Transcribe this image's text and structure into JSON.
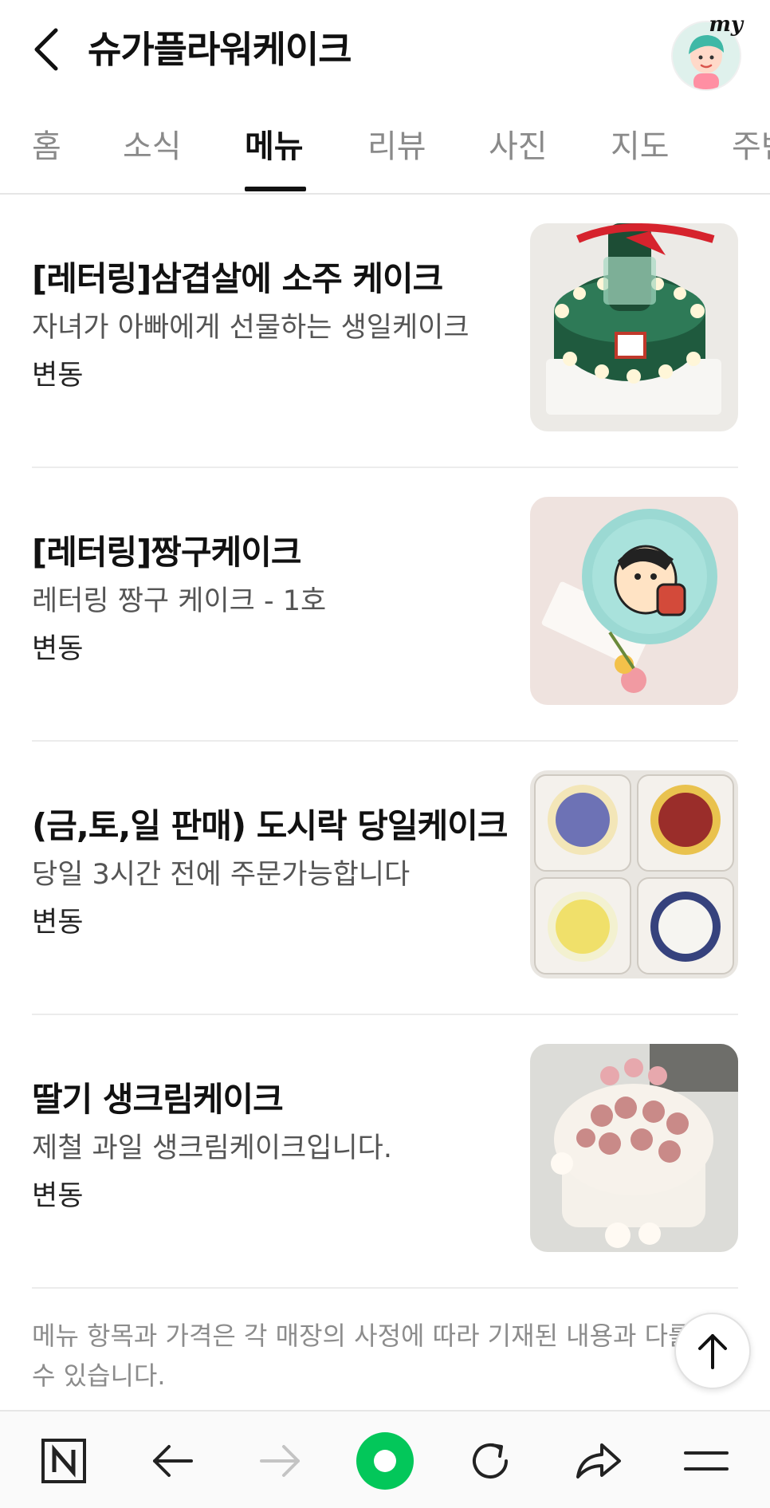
{
  "header": {
    "title": "슈가플라워케이크",
    "my_label": "my"
  },
  "tabs": [
    {
      "label": "홈",
      "active": false
    },
    {
      "label": "소식",
      "active": false
    },
    {
      "label": "메뉴",
      "active": true
    },
    {
      "label": "리뷰",
      "active": false
    },
    {
      "label": "사진",
      "active": false
    },
    {
      "label": "지도",
      "active": false
    },
    {
      "label": "주변",
      "active": false
    }
  ],
  "menu_items": [
    {
      "name": "[레터링]삼겹살에 소주 케이크",
      "description": "자녀가 아빠에게 선물하는 생일케이크",
      "price": "변동",
      "image": "soju-bottle-green-cake"
    },
    {
      "name": "[레터링]짱구케이크",
      "description": "레터링 짱구 케이크 - 1호",
      "price": "변동",
      "image": "shinchan-lettering-cake"
    },
    {
      "name": "(금,토,일 판매) 도시락 당일케이크",
      "description": "당일 3시간 전에 주문가능합니다",
      "price": "변동",
      "image": "lunchbox-mini-cakes"
    },
    {
      "name": "딸기 생크림케이크",
      "description": "제철 과일 생크림케이크입니다.",
      "price": "변동",
      "image": "strawberry-cream-cake"
    }
  ],
  "notice": "메뉴 항목과 가격은 각 매장의 사정에 따라 기재된 내용과 다를 수 있습니다.",
  "colors": {
    "accent_green": "#03c75a",
    "text_primary": "#111111",
    "text_secondary": "#555555",
    "text_muted": "#8c8c8c"
  },
  "bottom_bar": {
    "icons": [
      "naver-n-icon",
      "back-arrow-icon",
      "forward-arrow-icon",
      "green-home-icon",
      "refresh-icon",
      "share-icon",
      "menu-icon"
    ]
  }
}
